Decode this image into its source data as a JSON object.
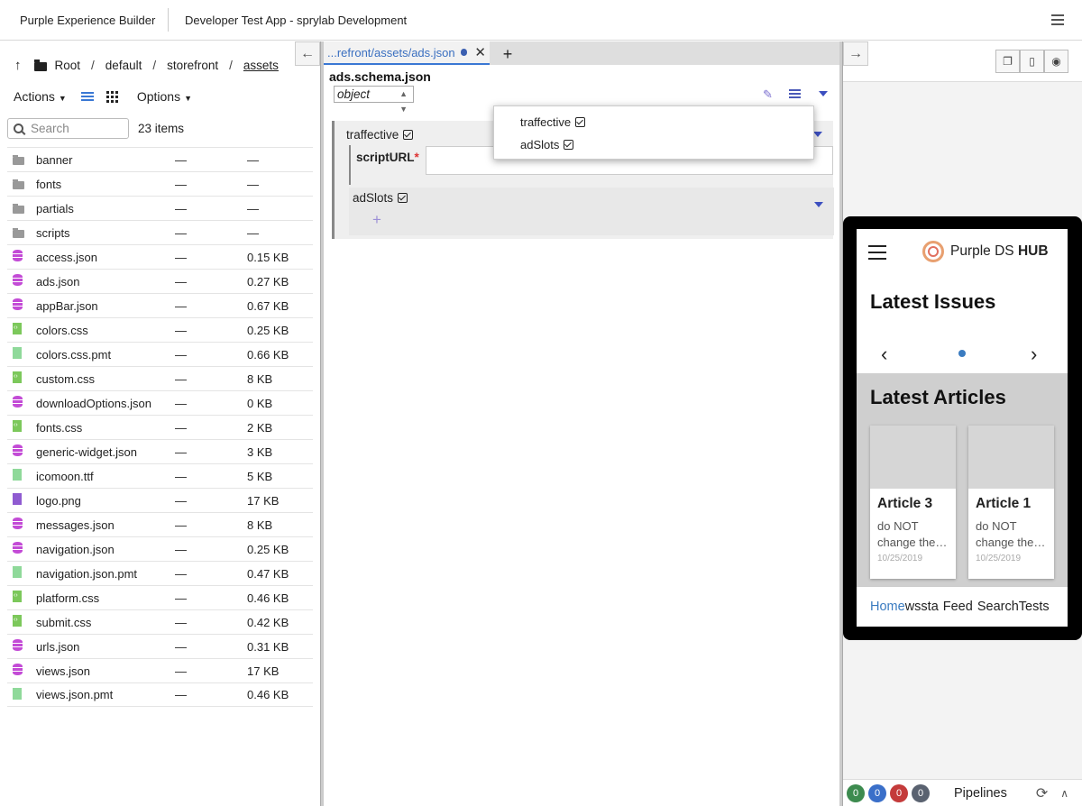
{
  "topbar": {
    "brand": "Purple Experience Builder",
    "app": "Developer Test App - sprylab Development"
  },
  "browser": {
    "breadcrumb": [
      "Root",
      "default",
      "storefront",
      "assets"
    ],
    "actions_label": "Actions",
    "options_label": "Options",
    "search_placeholder": "Search",
    "item_count": "23 items",
    "files": [
      {
        "icon": "folder",
        "name": "banner",
        "modified": "—",
        "size": "—"
      },
      {
        "icon": "folder",
        "name": "fonts",
        "modified": "—",
        "size": "—"
      },
      {
        "icon": "folder",
        "name": "partials",
        "modified": "—",
        "size": "—"
      },
      {
        "icon": "folder",
        "name": "scripts",
        "modified": "—",
        "size": "—"
      },
      {
        "icon": "db",
        "name": "access.json",
        "modified": "—",
        "size": "0.15 KB"
      },
      {
        "icon": "db",
        "name": "ads.json",
        "modified": "—",
        "size": "0.27 KB"
      },
      {
        "icon": "db",
        "name": "appBar.json",
        "modified": "—",
        "size": "0.67 KB"
      },
      {
        "icon": "code",
        "name": "colors.css",
        "modified": "—",
        "size": "0.25 KB"
      },
      {
        "icon": "file",
        "name": "colors.css.pmt",
        "modified": "—",
        "size": "0.66 KB"
      },
      {
        "icon": "code",
        "name": "custom.css",
        "modified": "—",
        "size": "8 KB"
      },
      {
        "icon": "db",
        "name": "downloadOptions.json",
        "modified": "—",
        "size": "0 KB"
      },
      {
        "icon": "code",
        "name": "fonts.css",
        "modified": "—",
        "size": "2 KB"
      },
      {
        "icon": "db",
        "name": "generic-widget.json",
        "modified": "—",
        "size": "3 KB"
      },
      {
        "icon": "file",
        "name": "icomoon.ttf",
        "modified": "—",
        "size": "5 KB"
      },
      {
        "icon": "img",
        "name": "logo.png",
        "modified": "—",
        "size": "17 KB"
      },
      {
        "icon": "db",
        "name": "messages.json",
        "modified": "—",
        "size": "8 KB"
      },
      {
        "icon": "db",
        "name": "navigation.json",
        "modified": "—",
        "size": "0.25 KB"
      },
      {
        "icon": "file",
        "name": "navigation.json.pmt",
        "modified": "—",
        "size": "0.47 KB"
      },
      {
        "icon": "code",
        "name": "platform.css",
        "modified": "—",
        "size": "0.46 KB"
      },
      {
        "icon": "code",
        "name": "submit.css",
        "modified": "—",
        "size": "0.42 KB"
      },
      {
        "icon": "db",
        "name": "urls.json",
        "modified": "—",
        "size": "0.31 KB"
      },
      {
        "icon": "db",
        "name": "views.json",
        "modified": "—",
        "size": "17 KB"
      },
      {
        "icon": "file",
        "name": "views.json.pmt",
        "modified": "—",
        "size": "0.46 KB"
      }
    ]
  },
  "editor": {
    "tab_label": "...refront/assets/ads.json",
    "schema_title": "ads.schema.json",
    "type_value": "object",
    "prop_traffective": "traffective",
    "prop_scripturl": "scriptURL",
    "required_mark": "*",
    "prop_adslots": "adSlots",
    "popup_items": [
      "traffective",
      "adSlots"
    ],
    "add_symbol": "+"
  },
  "preview": {
    "logo_text_regular": "Purple DS ",
    "logo_text_bold": "HUB",
    "latest_issues": "Latest Issues",
    "latest_articles": "Latest Articles",
    "articles": [
      {
        "title": "Article 3",
        "snippet": "do NOT change the…",
        "date": "10/25/2019"
      },
      {
        "title": "Article 1",
        "snippet": "do NOT change the…",
        "date": "10/25/2019"
      }
    ],
    "nav": [
      "Home",
      "wssta",
      "Feed",
      "Search",
      "Tests"
    ],
    "active_nav": "Home"
  },
  "footer": {
    "badges": [
      {
        "count": "0",
        "color": "#3d8b4f"
      },
      {
        "count": "0",
        "color": "#3a6fc9"
      },
      {
        "count": "0",
        "color": "#c43b3b"
      },
      {
        "count": "0",
        "color": "#5a6270"
      }
    ],
    "pipelines_label": "Pipelines"
  }
}
